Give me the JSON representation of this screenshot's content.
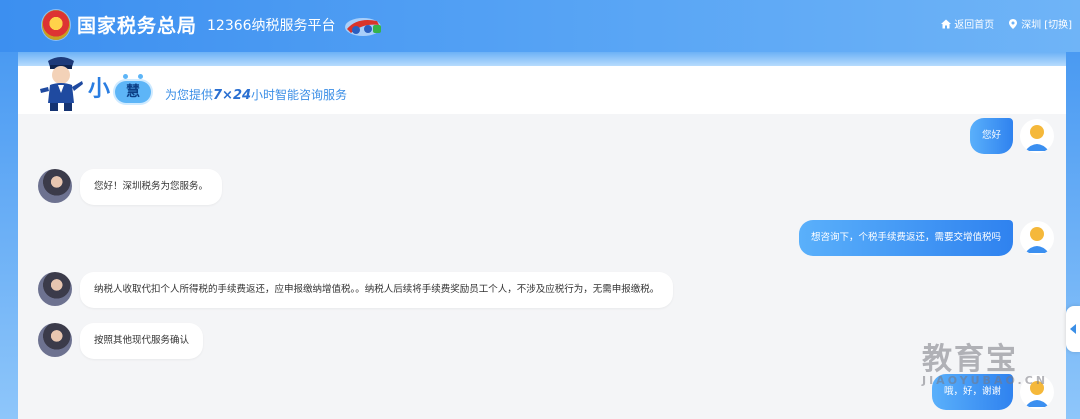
{
  "header": {
    "site_title": "国家税务总局",
    "platform": "12366纳税服务平台",
    "home_link": "返回首页",
    "location": "深圳",
    "switch_link": "[切换]"
  },
  "banner": {
    "brand_a": "小",
    "brand_b": "慧",
    "tagline_pre": "为您提供",
    "tagline_em": "7×24",
    "tagline_post": "小时智能咨询服务"
  },
  "messages": [
    {
      "from": "user",
      "text": "您好"
    },
    {
      "from": "agent",
      "text": "您好！深圳税务为您服务。"
    },
    {
      "from": "user",
      "text": "想咨询下，个税手续费返还，需要交增值税吗"
    },
    {
      "from": "agent",
      "text": "纳税人收取代扣个人所得税的手续费返还，应申报缴纳增值税。。纳税人后续将手续费奖励员工个人，不涉及应税行为，无需申报缴税。"
    },
    {
      "from": "agent",
      "text": "按照其他现代服务确认"
    },
    {
      "from": "user",
      "text": "哦，好，谢谢"
    }
  ],
  "watermark": {
    "cn": "教育宝",
    "en": "JIAOYUBAO.CN"
  },
  "icons": [
    "home-icon",
    "location-pin-icon",
    "chevron-left-icon"
  ],
  "colors": {
    "accent": "#2f82ef",
    "header": "#4a9af2",
    "chat_bg": "#f4f5f7"
  }
}
